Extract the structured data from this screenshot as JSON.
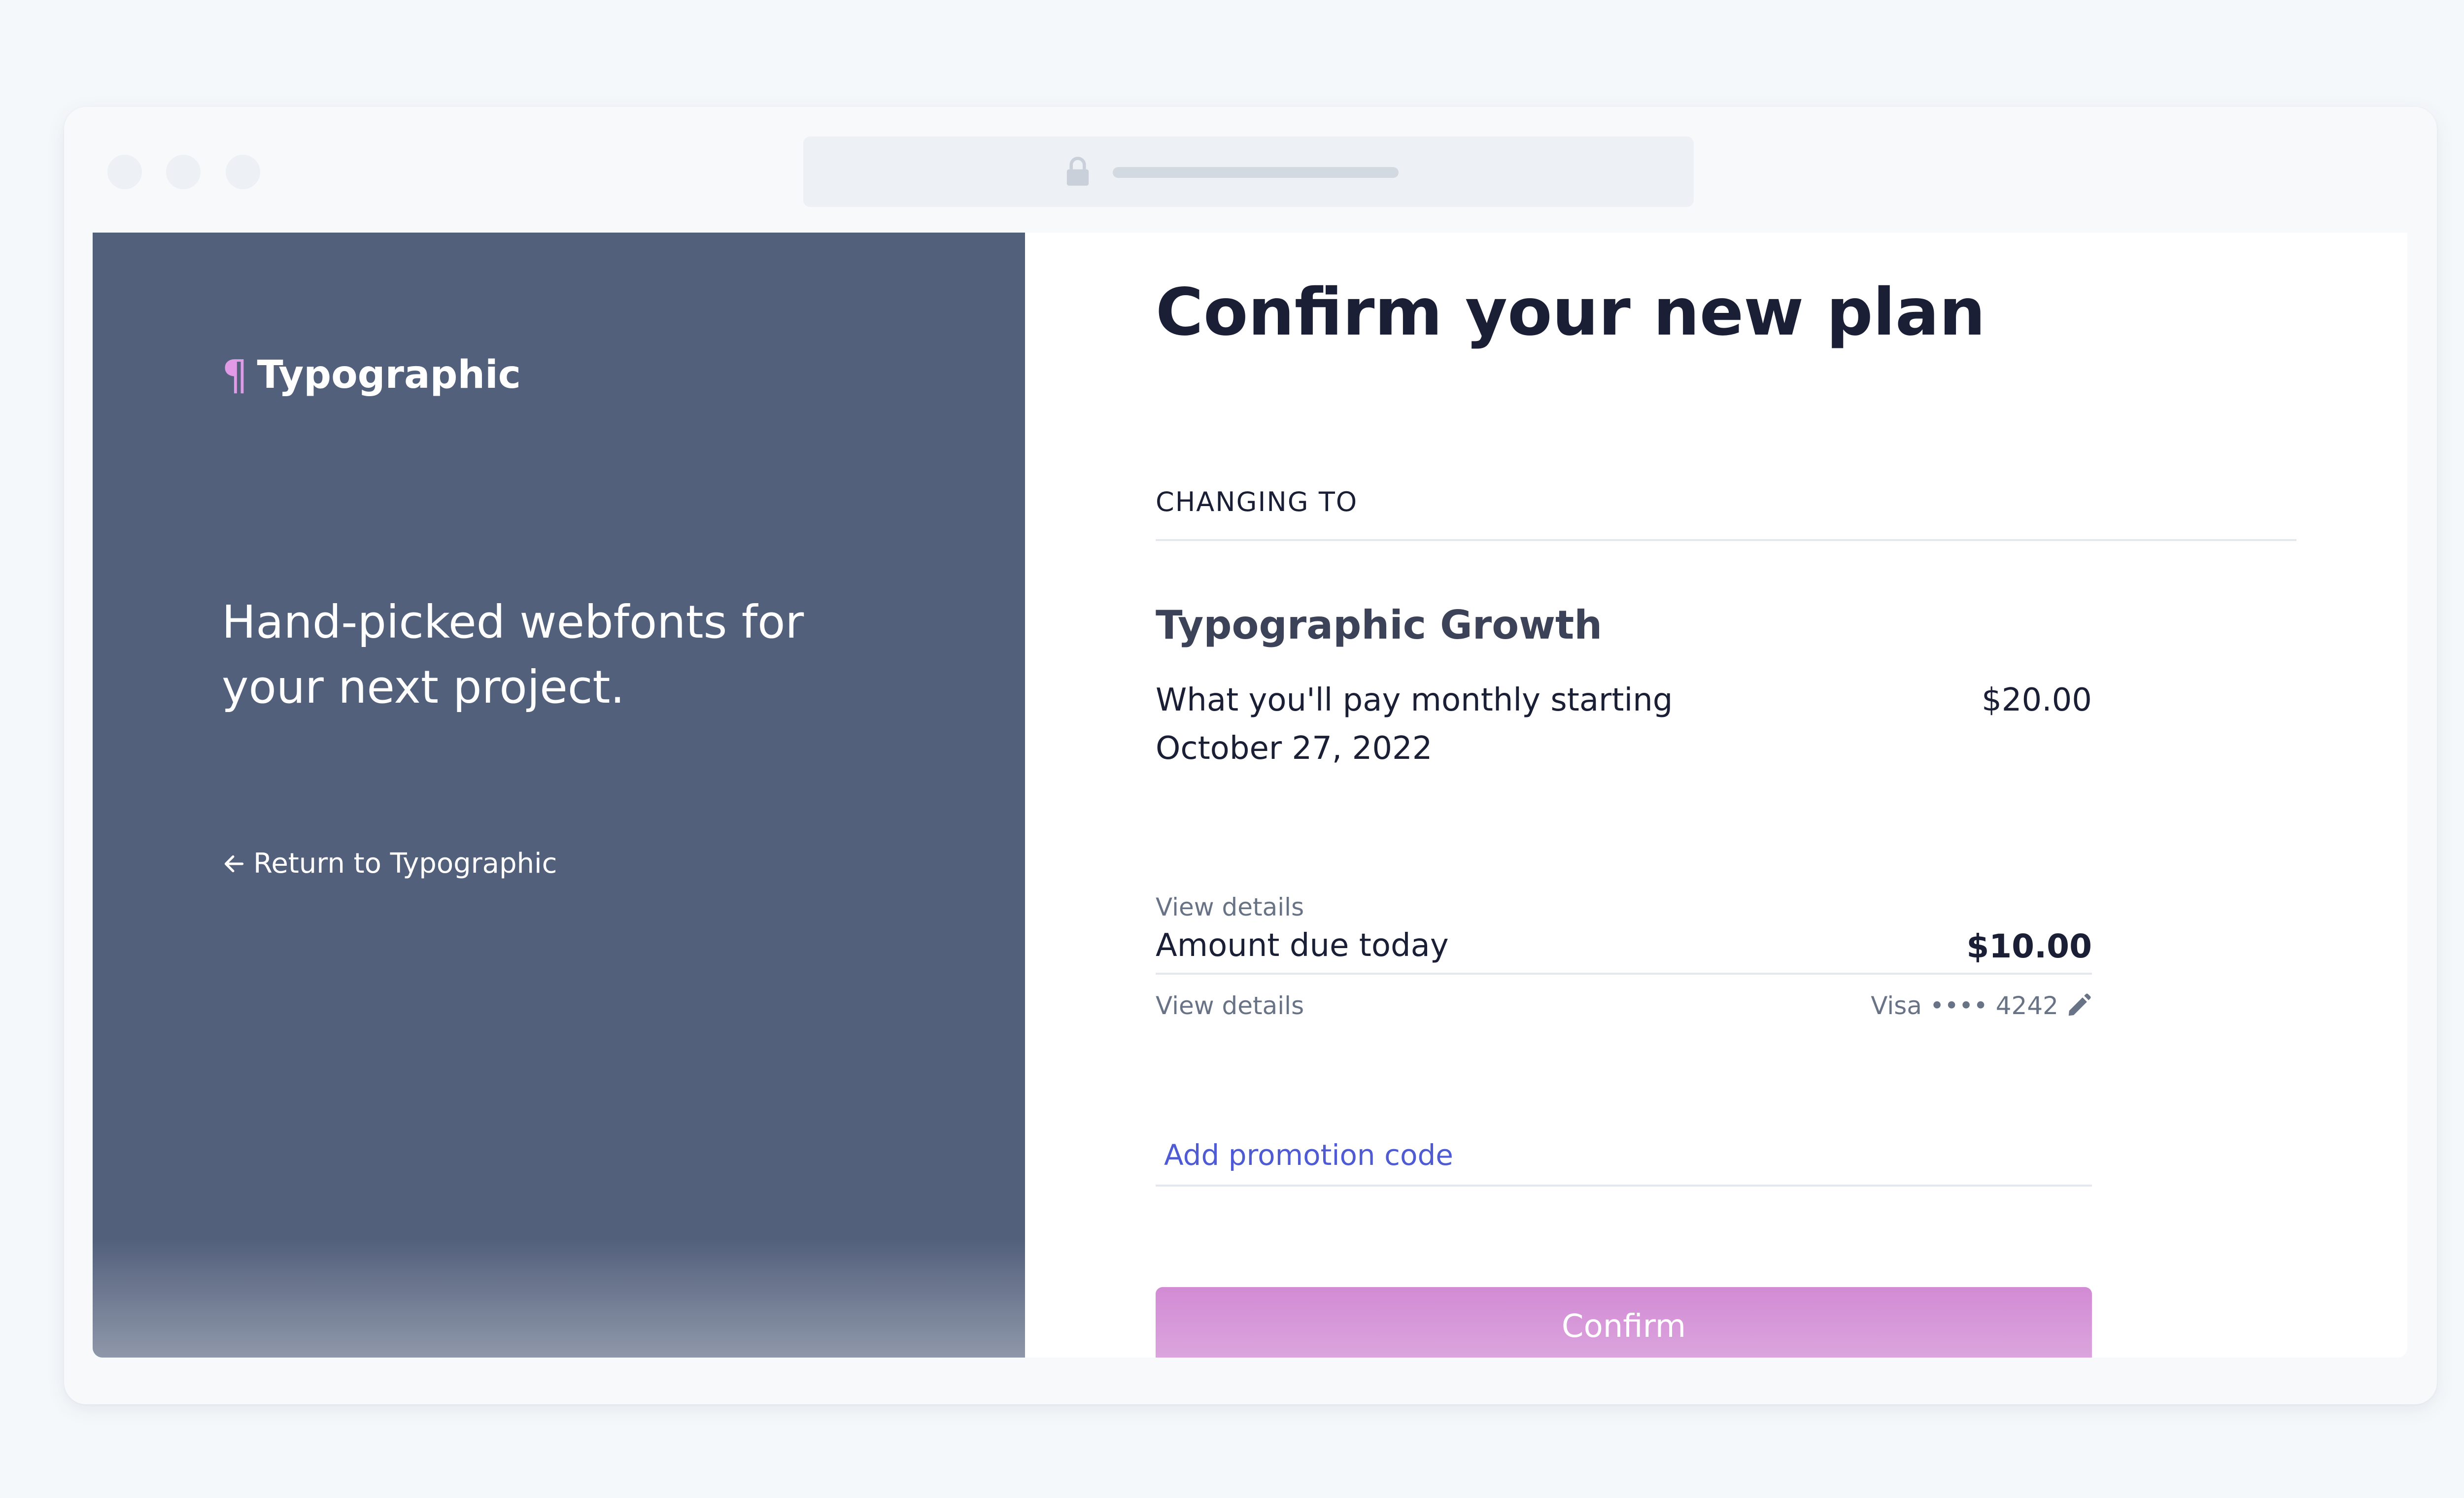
{
  "brand": {
    "icon": "pilcrow-icon",
    "name": "Typographic",
    "accent_color": "#e19ae6"
  },
  "sidebar": {
    "tagline": "Hand-picked webfonts for your next project.",
    "return_link": "Return to Typographic",
    "background_color": "#53607c"
  },
  "checkout": {
    "title": "Confirm your new plan",
    "section_label": "CHANGING TO",
    "plan": {
      "name": "Typographic Growth",
      "description": "What you'll pay monthly starting October 27, 2022",
      "price": "$20.00",
      "details_link": "View details"
    },
    "due": {
      "label": "Amount due today",
      "amount": "$10.00",
      "details_link": "View details",
      "payment_method": "Visa •••• 4242"
    },
    "promo_link": "Add promotion code",
    "confirm_label": "Confirm",
    "link_color": "#4f5bd5",
    "button_color": "#d28bd4"
  }
}
